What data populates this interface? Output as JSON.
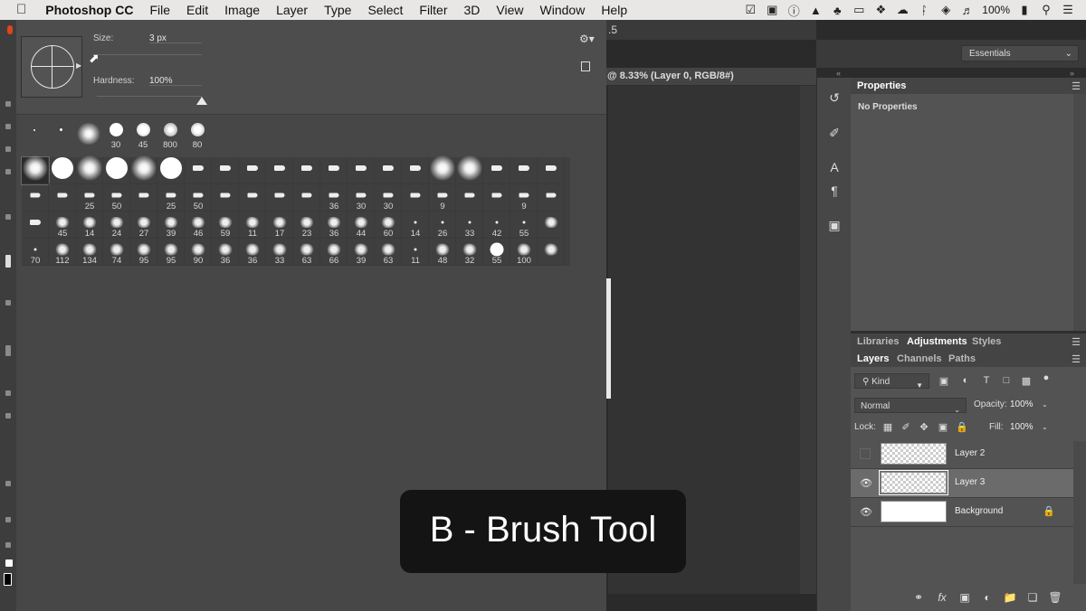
{
  "menubar": {
    "apple": "",
    "app_name": "Photoshop CC",
    "items": [
      "File",
      "Edit",
      "Image",
      "Layer",
      "Type",
      "Select",
      "Filter",
      "3D",
      "View",
      "Window",
      "Help"
    ],
    "battery": "100%"
  },
  "brush_picker": {
    "size_label": "Size:",
    "size_value": "3 px",
    "hardness_label": "Hardness:",
    "hardness_value": "100%",
    "recent_brushes": [
      "",
      "",
      "",
      "30",
      "45",
      "800",
      "80"
    ],
    "grid_rows": [
      [
        "",
        "",
        "",
        "",
        "",
        "",
        "",
        "",
        "",
        "",
        "",
        "",
        "",
        "",
        "",
        "",
        "",
        "",
        "",
        ""
      ],
      [
        "",
        "",
        "25",
        "50",
        "",
        "25",
        "50",
        "",
        "",
        "",
        "",
        "36",
        "30",
        "30",
        "",
        "9",
        "",
        "",
        "9",
        ""
      ],
      [
        "",
        "45",
        "14",
        "24",
        "27",
        "39",
        "46",
        "59",
        "11",
        "17",
        "23",
        "36",
        "44",
        "60",
        "14",
        "26",
        "33",
        "42",
        "55",
        ""
      ],
      [
        "70",
        "112",
        "134",
        "74",
        "95",
        "95",
        "90",
        "36",
        "36",
        "33",
        "63",
        "66",
        "39",
        "63",
        "11",
        "48",
        "32",
        "55",
        "100",
        ""
      ]
    ]
  },
  "document": {
    "version_fragment": ".5",
    "tab_title": "@ 8.33% (Layer 0, RGB/8#)"
  },
  "workspace": {
    "selected": "Essentials"
  },
  "properties_panel": {
    "tab": "Properties",
    "empty_text": "No Properties"
  },
  "adjust_tabs": [
    "Libraries",
    "Adjustments",
    "Styles"
  ],
  "layers_tabs": [
    "Layers",
    "Channels",
    "Paths"
  ],
  "layers_panel": {
    "kind_filter": "Kind",
    "blend_mode": "Normal",
    "opacity_label": "Opacity:",
    "opacity_value": "100%",
    "lock_label": "Lock:",
    "fill_label": "Fill:",
    "fill_value": "100%",
    "layers": [
      {
        "name": "Layer 2",
        "visible": false,
        "selected": false,
        "locked": false
      },
      {
        "name": "Layer 3",
        "visible": true,
        "selected": true,
        "locked": false
      },
      {
        "name": "Background",
        "visible": true,
        "selected": false,
        "locked": true
      }
    ]
  },
  "overlay": {
    "text": "B - Brush Tool"
  }
}
